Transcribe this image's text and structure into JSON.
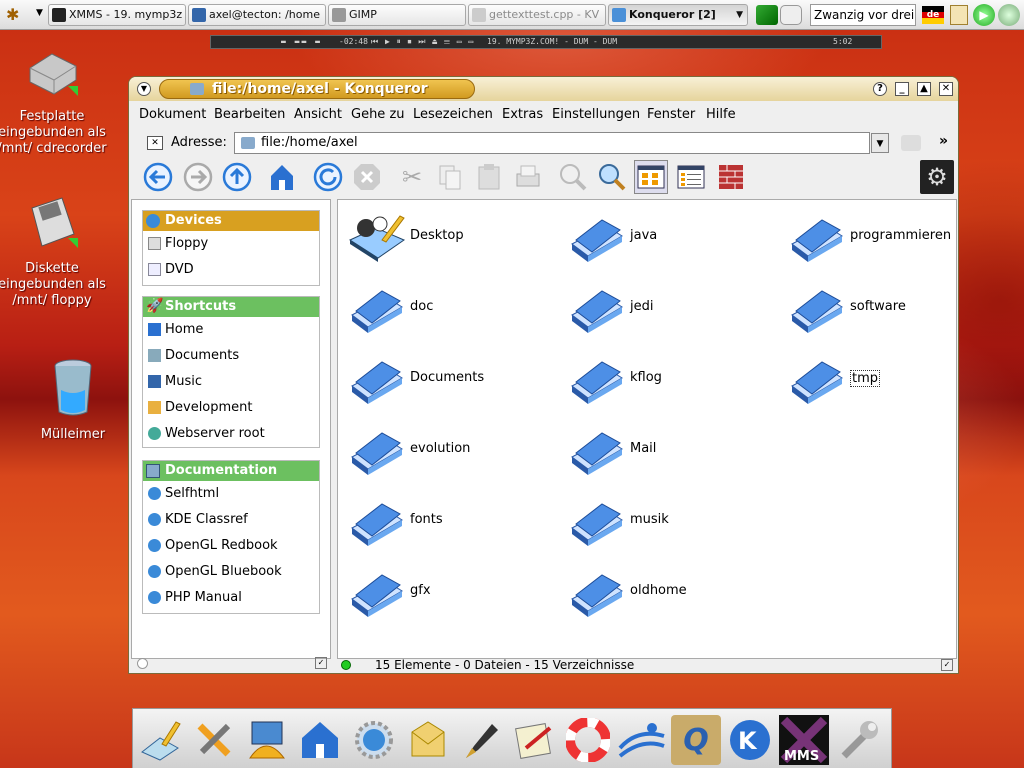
{
  "taskbar": {
    "tasks": [
      {
        "label": "XMMS - 19. mymp3z"
      },
      {
        "label": "axel@tecton: /home"
      },
      {
        "label": "GIMP"
      },
      {
        "label": "gettexttest.cpp - KV"
      },
      {
        "label": "Konqueror [2]"
      }
    ],
    "clock": "Zwanzig vor drei",
    "flag_label": "de"
  },
  "xmms": {
    "time": "-02:48",
    "title": "19. MYMP3Z.COM! - DUM - DUM",
    "duration": "5:02"
  },
  "desktop_icons": [
    {
      "label": "Festplatte eingebunden als /mnt/ cdrecorder",
      "icon": "harddisk-icon"
    },
    {
      "label": "Diskette eingebunden als /mnt/ floppy",
      "icon": "floppy-icon"
    },
    {
      "label": "Mülleimer",
      "icon": "trash-icon"
    }
  ],
  "window": {
    "title": "file:/home/axel - Konqueror",
    "menu": [
      "Dokument",
      "Bearbeiten",
      "Ansicht",
      "Gehe zu",
      "Lesezeichen",
      "Extras",
      "Einstellungen",
      "Fenster",
      "Hilfe"
    ],
    "address_label": "Adresse:",
    "address": "file:/home/axel"
  },
  "sidebar": {
    "sections": [
      {
        "title": "Devices",
        "color": "#d8a020",
        "items": [
          "Floppy",
          "DVD"
        ]
      },
      {
        "title": "Shortcuts",
        "color": "#6cc060",
        "items": [
          "Home",
          "Documents",
          "Music",
          "Development",
          "Webserver root"
        ]
      },
      {
        "title": "Documentation",
        "color": "#6cc060",
        "items": [
          "Selfhtml",
          "KDE Classref",
          "OpenGL Redbook",
          "OpenGL Bluebook",
          "PHP Manual"
        ]
      }
    ]
  },
  "files": [
    {
      "name": "Desktop",
      "col": 0,
      "row": 0
    },
    {
      "name": "doc",
      "col": 0,
      "row": 1
    },
    {
      "name": "Documents",
      "col": 0,
      "row": 2
    },
    {
      "name": "evolution",
      "col": 0,
      "row": 3
    },
    {
      "name": "fonts",
      "col": 0,
      "row": 4
    },
    {
      "name": "gfx",
      "col": 0,
      "row": 5
    },
    {
      "name": "java",
      "col": 1,
      "row": 0
    },
    {
      "name": "jedi",
      "col": 1,
      "row": 1
    },
    {
      "name": "kflog",
      "col": 1,
      "row": 2
    },
    {
      "name": "Mail",
      "col": 1,
      "row": 3
    },
    {
      "name": "musik",
      "col": 1,
      "row": 4
    },
    {
      "name": "oldhome",
      "col": 1,
      "row": 5
    },
    {
      "name": "programmieren",
      "col": 2,
      "row": 0
    },
    {
      "name": "software",
      "col": 2,
      "row": 1
    },
    {
      "name": "tmp",
      "col": 2,
      "row": 2
    }
  ],
  "status": "15 Elemente - 0 Dateien - 15 Verzeichnisse"
}
